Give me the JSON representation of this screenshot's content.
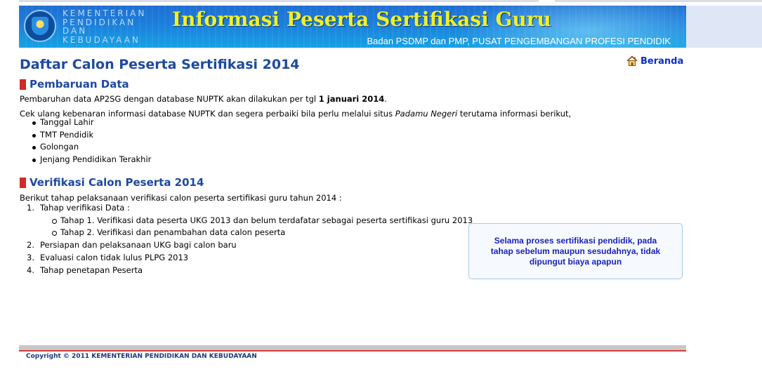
{
  "header": {
    "ministry_lines": [
      "KEMENTERIAN",
      "PENDIDIKAN",
      "DAN",
      "KEBUDAYAAN"
    ],
    "title": "Informasi Peserta Sertifikasi Guru",
    "subtitle": "Badan PSDMP dan PMP, PUSAT PENGEMBANGAN PROFESI PENDIDIK"
  },
  "page": {
    "title": "Daftar Calon Peserta Sertifikasi 2014",
    "home_link": "Beranda"
  },
  "section_update": {
    "heading": "Pembaruan Data",
    "p1_text": "Pembaruhan data AP2SG dengan database NUPTK akan dilakukan per tgl ",
    "p1_bold": "1 januari 2014",
    "p1_end": ".",
    "p2_text": "Cek ulang kebenaran informasi database NUPTK dan segera perbaiki bila perlu melalui situs ",
    "p2_italic": "Padamu Negeri",
    "p2_end": " terutama informasi berikut,",
    "items": [
      "Tanggal Lahir",
      "TMT Pendidik",
      "Golongan",
      "Jenjang Pendidikan Terakhir"
    ]
  },
  "section_verify": {
    "heading": "Verifikasi Calon Peserta 2014",
    "intro": "Berikut tahap pelaksanaan verifikasi calon peserta sertifikasi guru tahun 2014 :",
    "steps": [
      {
        "num": "1.",
        "label": "Tahap verifikasi Data :"
      },
      {
        "num": "2.",
        "label": "Persiapan dan pelaksanaan UKG bagi calon baru"
      },
      {
        "num": "3.",
        "label": "Evaluasi calon tidak lulus PLPG 2013"
      },
      {
        "num": "4.",
        "label": "Tahap penetapan Peserta"
      }
    ],
    "substeps": [
      "Tahap 1. Verifikasi data peserta UKG 2013 dan belum terdafatar sebagai peserta sertifikasi guru 2013",
      "Tahap 2. Verifikasi dan penambahan data calon peserta"
    ]
  },
  "notice": "Selama proses sertifikasi pendidik, pada tahap sebelum maupun sesudahnya, tidak dipungut biaya apapun",
  "footer": {
    "copyright": "Copyright © 2011 KEMENTERIAN PENDIDIKAN DAN KEBUDAYAAN"
  },
  "colors": {
    "heading_blue": "#1c4aa0",
    "accent_red": "#cf2b2b",
    "banner_title_yellow": "#f1ef2a",
    "notice_text": "#1a24b8"
  },
  "icons": {
    "home": "home-icon"
  }
}
